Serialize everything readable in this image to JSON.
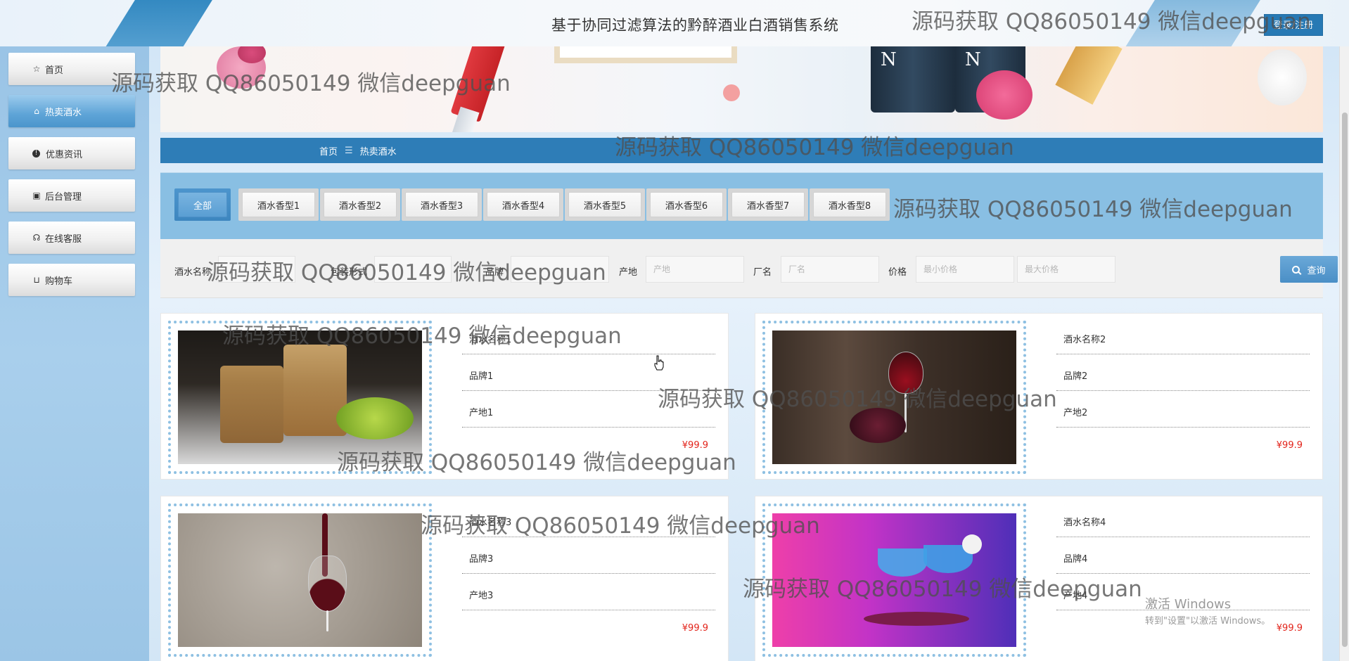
{
  "header": {
    "title": "基于协同过滤算法的黔醉酒业白酒销售系统",
    "login_label": "登录/注册"
  },
  "sidebar": {
    "items": [
      {
        "icon": "star-icon",
        "label": "首页"
      },
      {
        "icon": "home-icon",
        "label": "热卖酒水",
        "active": true
      },
      {
        "icon": "info-icon",
        "label": "优惠资讯"
      },
      {
        "icon": "calendar-icon",
        "label": "后台管理"
      },
      {
        "icon": "headset-icon",
        "label": "在线客服"
      },
      {
        "icon": "cart-icon",
        "label": "购物车"
      }
    ]
  },
  "breadcrumb": {
    "home": "首页",
    "separator": "☰",
    "current": "热卖酒水"
  },
  "categories": [
    "全部",
    "酒水香型1",
    "酒水香型2",
    "酒水香型3",
    "酒水香型4",
    "酒水香型5",
    "酒水香型6",
    "酒水香型7",
    "酒水香型8"
  ],
  "search": {
    "name_label": "酒水名称",
    "type_label": "包装形式",
    "brand_label": "品牌",
    "origin_label": "产地",
    "origin_placeholder": "产地",
    "factory_label": "厂名",
    "factory_placeholder": "厂名",
    "price_label": "价格",
    "min_placeholder": "最小价格",
    "max_placeholder": "最大价格",
    "button_label": "查询"
  },
  "products": [
    {
      "name": "酒水名称1",
      "brand": "品牌1",
      "origin": "产地1",
      "price": "¥99.9"
    },
    {
      "name": "酒水名称2",
      "brand": "品牌2",
      "origin": "产地2",
      "price": "¥99.9"
    },
    {
      "name": "酒水名称3",
      "brand": "品牌3",
      "origin": "产地3",
      "price": "¥99.9"
    },
    {
      "name": "酒水名称4",
      "brand": "品牌4",
      "origin": "产地4",
      "price": "¥99.9"
    }
  ],
  "watermark": "源码获取 QQ86050149 微信deepguan",
  "windows_activation": {
    "title": "激活 Windows",
    "subtitle": "转到\"设置\"以激活 Windows。"
  },
  "colors": {
    "accent": "#2e7db7",
    "price": "#e2231a",
    "sidebar": "#9ac4e6"
  }
}
